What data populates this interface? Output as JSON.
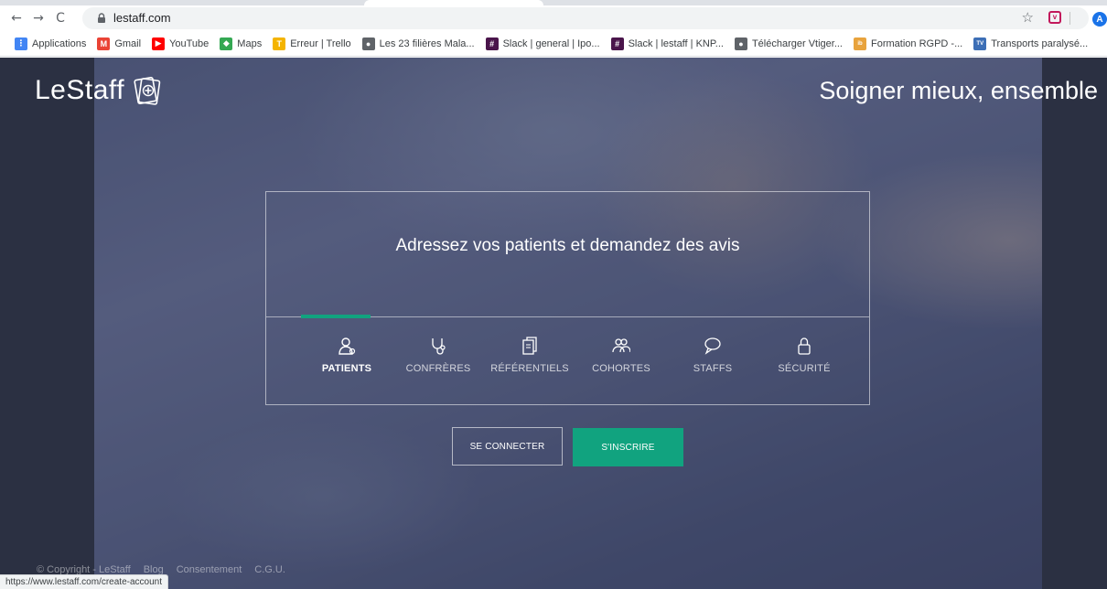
{
  "browser": {
    "url": "lestaff.com",
    "nav": {
      "back": "←",
      "forward": "→",
      "reload": "C"
    },
    "bookmarks": [
      {
        "label": "Applications",
        "icon": "apps-grid-icon",
        "color": "#4285f4"
      },
      {
        "label": "Gmail",
        "icon": "gmail-icon",
        "color": "#ea4335"
      },
      {
        "label": "YouTube",
        "icon": "youtube-icon",
        "color": "#ff0000"
      },
      {
        "label": "Maps",
        "icon": "maps-icon",
        "color": "#34a853"
      },
      {
        "label": "Erreur | Trello",
        "icon": "trello-icon",
        "color": "#f4b400"
      },
      {
        "label": "Les 23 filières Mala...",
        "icon": "globe-icon",
        "color": "#5f6368"
      },
      {
        "label": "Slack | general | Ipo...",
        "icon": "slack-icon",
        "color": "#4a154b"
      },
      {
        "label": "Slack | lestaff | KNP...",
        "icon": "slack-icon",
        "color": "#4a154b"
      },
      {
        "label": "Télécharger Vtiger...",
        "icon": "globe-icon",
        "color": "#5f6368"
      },
      {
        "label": "Formation RGPD -...",
        "icon": "ib-icon",
        "color": "#e8a33d"
      },
      {
        "label": "Transports paralysé...",
        "icon": "tv-icon",
        "color": "#3d6fb6"
      }
    ],
    "avatar_letter": "A",
    "status_url": "https://www.lestaff.com/create-account"
  },
  "page": {
    "brand": "LeStaff",
    "tagline": "Soigner mieux, ensemble",
    "feature_title": "Adressez vos patients et demandez des avis",
    "features": [
      {
        "label": "PATIENTS",
        "icon": "patient-icon",
        "active": true
      },
      {
        "label": "CONFRÈRES",
        "icon": "stethoscope-icon",
        "active": false
      },
      {
        "label": "RÉFÉRENTIELS",
        "icon": "documents-icon",
        "active": false
      },
      {
        "label": "COHORTES",
        "icon": "group-icon",
        "active": false
      },
      {
        "label": "STAFFS",
        "icon": "chat-icon",
        "active": false
      },
      {
        "label": "SÉCURITÉ",
        "icon": "lock-icon",
        "active": false
      }
    ],
    "buttons": {
      "login": "SE CONNECTER",
      "signup": "S'INSCRIRE"
    },
    "footer": [
      "© Copyright - LeStaff",
      "Blog",
      "Consentement",
      "C.G.U."
    ],
    "colors": {
      "accent": "#11a37f",
      "background": "#2b3042"
    }
  }
}
